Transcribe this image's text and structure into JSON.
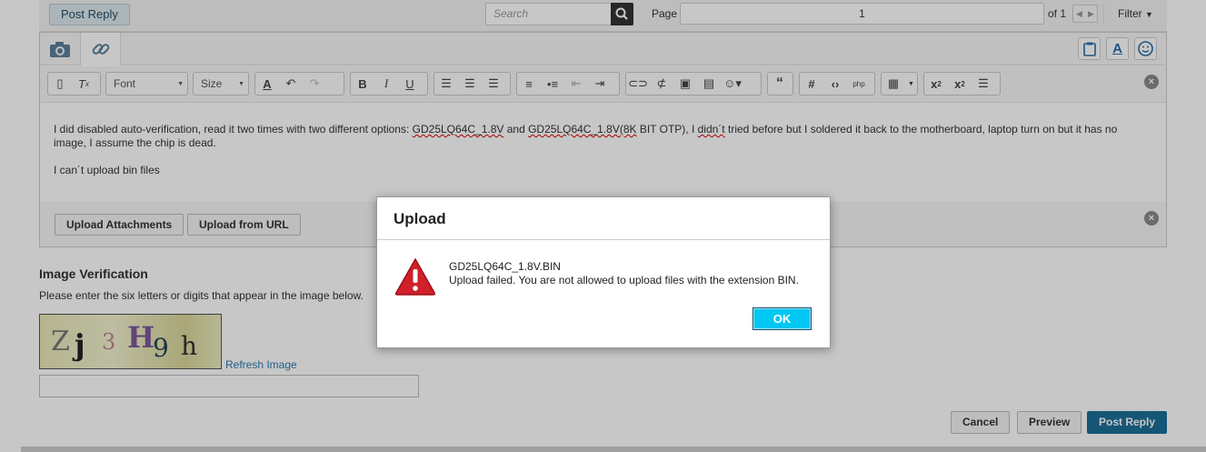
{
  "topbar": {
    "post_reply_label": "Post Reply",
    "search_placeholder": "Search",
    "page_label": "Page",
    "page_value": "1",
    "of_label": "of 1",
    "filter_label": "Filter"
  },
  "toolbar": {
    "font_label": "Font",
    "size_label": "Size"
  },
  "editor": {
    "para1": {
      "t1": "I did disabled auto-verification, read it two times with two different options: ",
      "s1": "GD25LQ64C_1.8V",
      "t2": " and ",
      "s2": "GD25LQ64C_1.8V(8K",
      "t3": " BIT OTP), I ",
      "s3": "didn´t",
      "t4": " tried before but I soldered it back to the motherboard, laptop turn on but it has no image, I assume the chip is dead."
    },
    "para2": "I can´t upload bin files"
  },
  "attachments": {
    "upload_attachments": "Upload Attachments",
    "upload_from_url": "Upload from URL"
  },
  "verification": {
    "title": "Image Verification",
    "description": "Please enter the six letters or digits that appear in the image below.",
    "captcha_chars": [
      "Z",
      "j",
      "3",
      "H",
      "9",
      "h"
    ],
    "refresh_label": "Refresh Image"
  },
  "actions": {
    "cancel": "Cancel",
    "preview": "Preview",
    "post_reply": "Post Reply"
  },
  "dialog": {
    "title": "Upload",
    "filename": "GD25LQ64C_1.8V.BIN",
    "message": "Upload failed. You are not allowed to upload files with the extension BIN.",
    "ok_label": "OK"
  },
  "colors": {
    "accent": "#1c6f98",
    "ok_button": "#00c8f2",
    "error_icon": "#d0202a",
    "link": "#2a7ab0"
  }
}
